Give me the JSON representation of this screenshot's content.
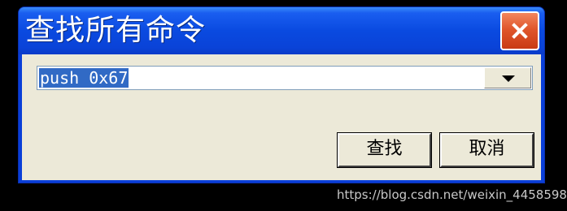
{
  "dialog": {
    "title": "查找所有命令",
    "close_icon": "close-icon"
  },
  "combo": {
    "value": "push 0x67",
    "arrow_icon": "chevron-down-icon"
  },
  "buttons": {
    "find_label": "查找",
    "cancel_label": "取消"
  },
  "watermark": "https://blog.csdn.net/weixin_44585983",
  "colors": {
    "titlebar": "#0a4ae0",
    "close_button": "#e0562c",
    "client_bg": "#ece9d8",
    "selection": "#316ac5"
  }
}
